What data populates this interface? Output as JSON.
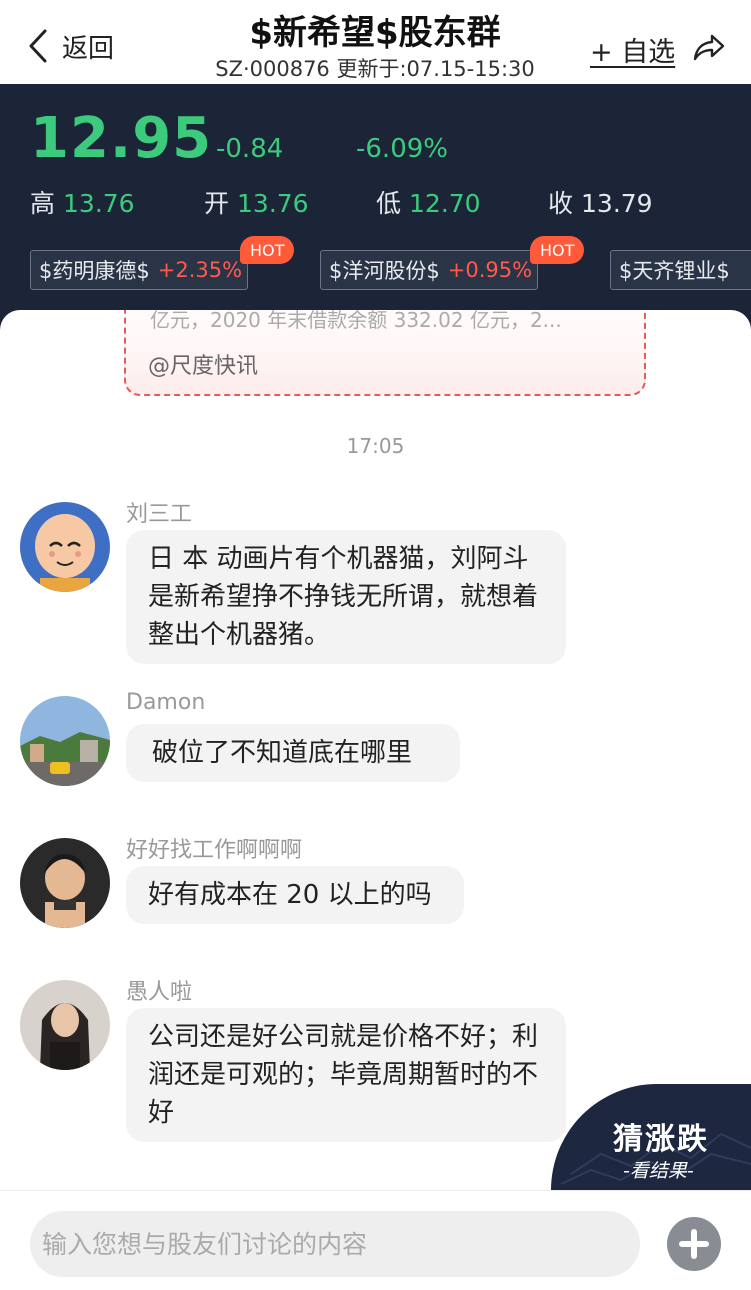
{
  "header": {
    "back_label": "返回",
    "title": "$新希望$股东群",
    "subtitle": "SZ·000876 更新于:07.15-15:30",
    "watch_label": "+ 自选"
  },
  "quote": {
    "price": "12.95",
    "change": "-0.84",
    "change_pct": "-6.09%",
    "stats": [
      {
        "label": "高",
        "value": "13.76"
      },
      {
        "label": "开",
        "value": "13.76"
      },
      {
        "label": "低",
        "value": "12.70"
      },
      {
        "label": "收",
        "value": "13.79"
      }
    ],
    "tags": [
      {
        "name": "$药明康德$",
        "change": "+2.35%",
        "badge": "HOT"
      },
      {
        "name": "$洋河股份$",
        "change": "+0.95%",
        "badge": "HOT"
      },
      {
        "name": "$天齐锂业$",
        "change": "",
        "badge": ""
      }
    ]
  },
  "news_card": {
    "text": "亿元，2020 年末借款余额 332.02 亿元，2...",
    "source": "@尺度快讯"
  },
  "timestamp": "17:05",
  "messages": [
    {
      "user": "刘三工",
      "text": "日 本 动画片有个机器猫，刘阿斗是新希望挣不挣钱无所谓，就想着整出个机器猪。"
    },
    {
      "user": "Damon",
      "text": "破位了不知道底在哪里"
    },
    {
      "user": "好好找工作啊啊啊",
      "text": "好有成本在 20 以上的吗"
    },
    {
      "user": "愚人啦",
      "text": "公司还是好公司就是价格不好；利润还是可观的；毕竟周期暂时的不好"
    }
  ],
  "guess": {
    "title": "猜涨跌",
    "subtitle": "-看结果-"
  },
  "input": {
    "placeholder": "输入您想与股友们讨论的内容",
    "value": ""
  },
  "colors": {
    "quote_bg": "#1b2537",
    "down_green": "#3ccb7c",
    "up_red": "#ff5a4e",
    "hot_badge": "#ff5a3a"
  }
}
